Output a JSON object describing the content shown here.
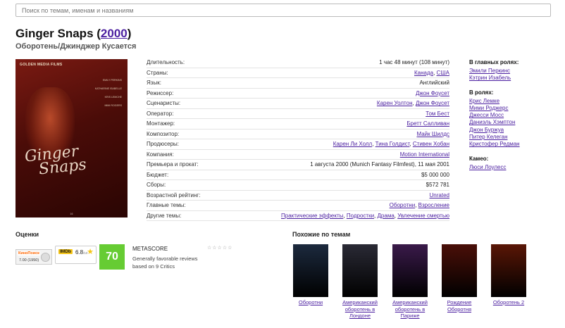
{
  "search": {
    "placeholder": "Поиск по темам, именам и названиям"
  },
  "movie": {
    "title": "Ginger Snaps",
    "year": "2000",
    "subtitle": "Оборотень/Джинджер Кусается"
  },
  "poster": {
    "studio": "GOLDEN MEDIA FILMS",
    "names": [
      "EMILY PERKINS",
      "KATHARINE ISABELLE",
      "KRIS LEMCHE",
      "MIMI ROGERS"
    ],
    "title_line1": "Ginger",
    "title_line2": "Snaps",
    "rating_badge": "16"
  },
  "details": [
    {
      "key": "Длительность:",
      "values": [
        {
          "text": "1 час 48 минут (108 минут)",
          "link": false
        }
      ]
    },
    {
      "key": "Страны:",
      "values": [
        {
          "text": "Канада",
          "link": true
        },
        {
          "text": "США",
          "link": true
        }
      ]
    },
    {
      "key": "Язык:",
      "values": [
        {
          "text": "Английский",
          "link": false
        }
      ]
    },
    {
      "key": "Режиссер:",
      "values": [
        {
          "text": "Джон Фоусет",
          "link": true
        }
      ]
    },
    {
      "key": "Сценаристы:",
      "values": [
        {
          "text": "Карен Уолтон",
          "link": true
        },
        {
          "text": "Джон Фоусет",
          "link": true
        }
      ]
    },
    {
      "key": "Оператор:",
      "values": [
        {
          "text": "Том Бест",
          "link": true
        }
      ]
    },
    {
      "key": "Монтажер:",
      "values": [
        {
          "text": "Бретт Салливан",
          "link": true
        }
      ]
    },
    {
      "key": "Композитор:",
      "values": [
        {
          "text": "Майк Шилдс",
          "link": true
        }
      ]
    },
    {
      "key": "Продюсеры:",
      "values": [
        {
          "text": "Карен Ли Холл",
          "link": true
        },
        {
          "text": "Тина Голдист",
          "link": true
        },
        {
          "text": "Стивен Хобан",
          "link": true
        }
      ]
    },
    {
      "key": "Компания:",
      "values": [
        {
          "text": "Motion International",
          "link": true
        }
      ]
    },
    {
      "key": "Премьера и прокат:",
      "values": [
        {
          "text": "1 августа 2000 (Munich Fantasy Filmfest), 11 мая 2001",
          "link": false
        }
      ]
    },
    {
      "key": "Бюджет:",
      "values": [
        {
          "text": "$5 000 000",
          "link": false
        }
      ]
    },
    {
      "key": "Сборы:",
      "values": [
        {
          "text": "$572 781",
          "link": false
        }
      ]
    },
    {
      "key": "Возрастной рейтинг:",
      "values": [
        {
          "text": "Unrated",
          "link": true
        }
      ]
    },
    {
      "key": "Главные темы:",
      "values": [
        {
          "text": "Оборотни",
          "link": true
        },
        {
          "text": "Взросление",
          "link": true
        }
      ]
    },
    {
      "key": "Другие темы:",
      "values": [
        {
          "text": "Практические эффекты",
          "link": true
        },
        {
          "text": "Подростки",
          "link": true
        },
        {
          "text": "Драма",
          "link": true
        },
        {
          "text": "Увлечение смертью",
          "link": true
        }
      ]
    }
  ],
  "cast": {
    "lead_title": "В главных ролях:",
    "lead": [
      "Эмили Перкинс",
      "Кэтрин Изабель"
    ],
    "roles_title": "В ролях:",
    "roles": [
      "Крис Лемке",
      "Мими Роджерс",
      "Джесси Мосс",
      "Даниэль Хэмптон",
      "Джон Буржуа",
      "Питер Келеган",
      "Кристофер Редман"
    ],
    "cameo_title": "Камео:",
    "cameo": [
      "Люси Лоулесс"
    ]
  },
  "ratings": {
    "title": "Оценки",
    "kinopoisk": {
      "logo": "КиноПоиск",
      "score": "7.00",
      "votes": "(1950)"
    },
    "imdb": {
      "logo": "IMDb",
      "score": "6.8",
      "scale": "/10"
    },
    "metascore": {
      "value": "70",
      "label": "METASCORE",
      "description": "Generally favorable reviews based on 9 Critics",
      "color": "#66cc33"
    },
    "stars": "☆☆☆☆☆"
  },
  "similar": {
    "title": "Похожие по темам",
    "items": [
      {
        "caption": "Оборотни",
        "cover_color": "#1c2a3e"
      },
      {
        "caption": "Американский оборотень в Лондоне",
        "cover_color": "#2a2a35"
      },
      {
        "caption": "Американский оборотень в Париже",
        "cover_color": "#3a1a4a"
      },
      {
        "caption": "Рождение Оборотня",
        "cover_color": "#4a0f08"
      },
      {
        "caption": "Оборотень 2",
        "cover_color": "#5a1606"
      }
    ]
  }
}
